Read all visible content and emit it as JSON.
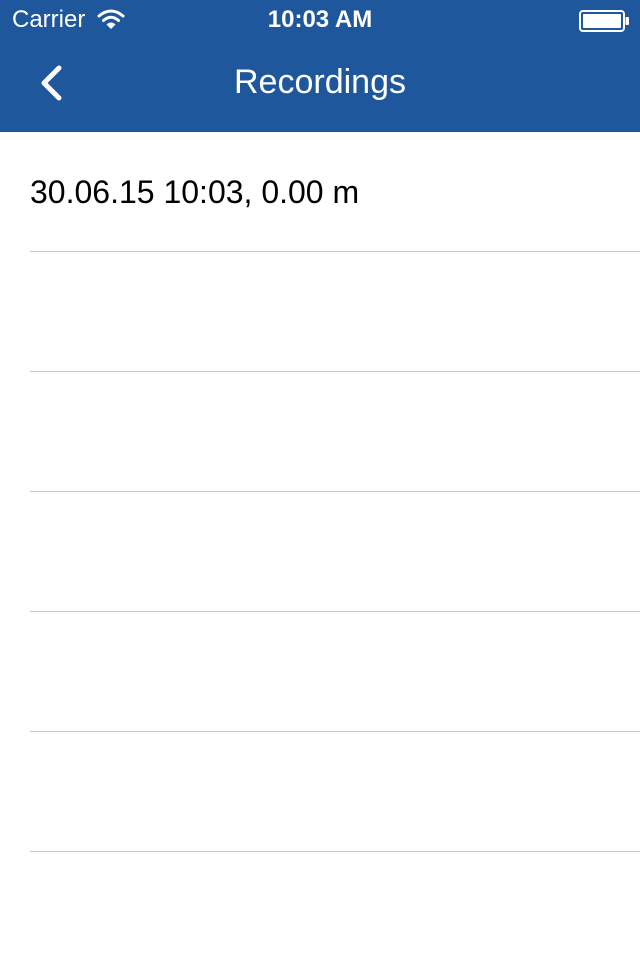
{
  "status_bar": {
    "carrier": "Carrier",
    "time": "10:03 AM",
    "icons": [
      "wifi-icon",
      "battery-icon"
    ]
  },
  "nav": {
    "title": "Recordings",
    "back_icon": "chevron-left-icon"
  },
  "recordings": [
    {
      "label": "30.06.15 10:03, 0.00 m"
    }
  ],
  "colors": {
    "nav_background": "#1e579b",
    "nav_text": "#ffffff",
    "separator": "#c8c7cc",
    "background": "#ffffff",
    "text": "#000000"
  }
}
